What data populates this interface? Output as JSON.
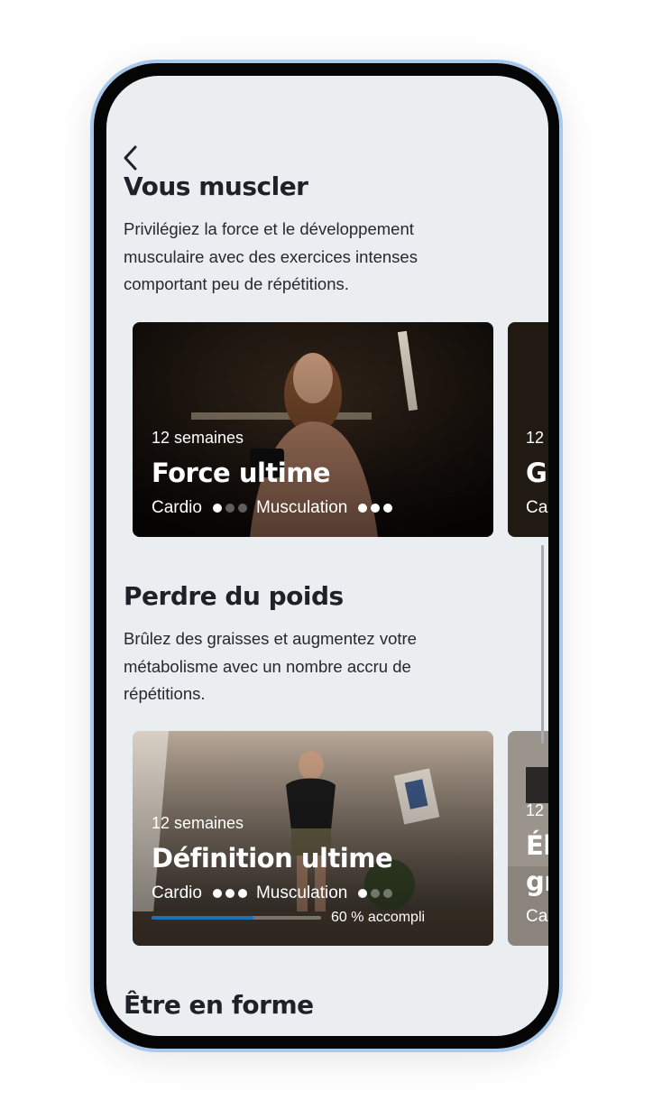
{
  "colors": {
    "accent": "#1a73b8",
    "screen_bg": "#ebeef1",
    "frame_highlight": "#a9c9ec"
  },
  "nav": {
    "back_icon": "chevron-left-icon"
  },
  "sections": [
    {
      "title": "Vous muscler",
      "description": "Privilégiez la force et le développement musculaire avec des exercices intenses comportant peu de répétitions.",
      "cards": [
        {
          "weeks": "12 semaines",
          "title": "Force ultime",
          "cardio_label": "Cardio",
          "cardio_level": 1,
          "muscu_label": "Musculation",
          "muscu_level": 3
        },
        {
          "weeks": "12",
          "title": "G",
          "cardio_label": "Ca"
        }
      ]
    },
    {
      "title": "Perdre du poids",
      "description": "Brûlez des graisses et augmentez votre métabolisme avec un nombre accru de répétitions.",
      "cards": [
        {
          "weeks": "12 semaines",
          "title": "Définition ultime",
          "cardio_label": "Cardio",
          "cardio_level": 3,
          "muscu_label": "Musculation",
          "muscu_level": 1,
          "progress": 0.6,
          "progress_label": "60 % accompli"
        },
        {
          "weeks": "12",
          "title_line1": "Él",
          "title_line2": "gr",
          "cardio_label": "Ca"
        }
      ]
    },
    {
      "title": "Être en forme"
    }
  ]
}
